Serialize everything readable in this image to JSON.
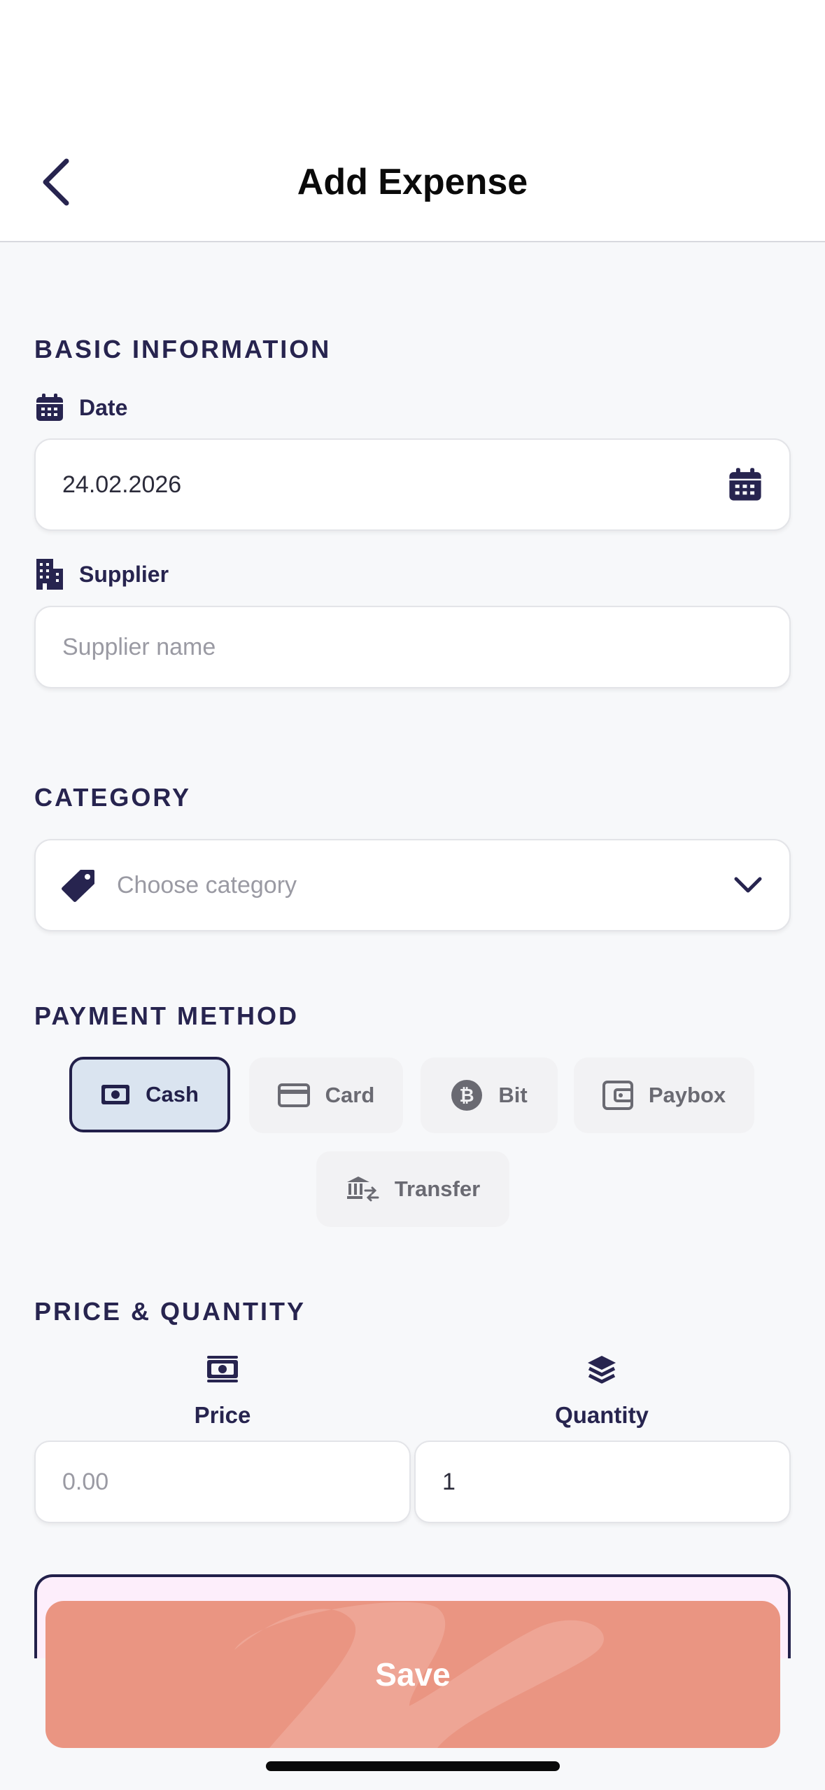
{
  "header": {
    "title": "Add Expense"
  },
  "basic": {
    "section_title": "BASIC INFORMATION",
    "date_label": "Date",
    "date_value": "24.02.2026",
    "supplier_label": "Supplier",
    "supplier_placeholder": "Supplier name"
  },
  "category": {
    "section_title": "CATEGORY",
    "placeholder": "Choose category"
  },
  "payment": {
    "section_title": "PAYMENT METHOD",
    "methods": [
      {
        "label": "Cash",
        "icon": "cash-icon",
        "selected": true
      },
      {
        "label": "Card",
        "icon": "credit-card-icon",
        "selected": false
      },
      {
        "label": "Bit",
        "icon": "bitcoin-icon",
        "selected": false
      },
      {
        "label": "Paybox",
        "icon": "wallet-icon",
        "selected": false
      },
      {
        "label": "Transfer",
        "icon": "bank-transfer-icon",
        "selected": false
      }
    ]
  },
  "price_quantity": {
    "section_title": "PRICE & QUANTITY",
    "price_label": "Price",
    "price_placeholder": "0.00",
    "quantity_label": "Quantity",
    "quantity_value": "1"
  },
  "footer": {
    "save_label": "Save"
  },
  "colors": {
    "primary": "#22204a",
    "selected_chip_bg": "#dae4f0",
    "save_button": "#ea9582",
    "background": "#f7f8fa"
  }
}
